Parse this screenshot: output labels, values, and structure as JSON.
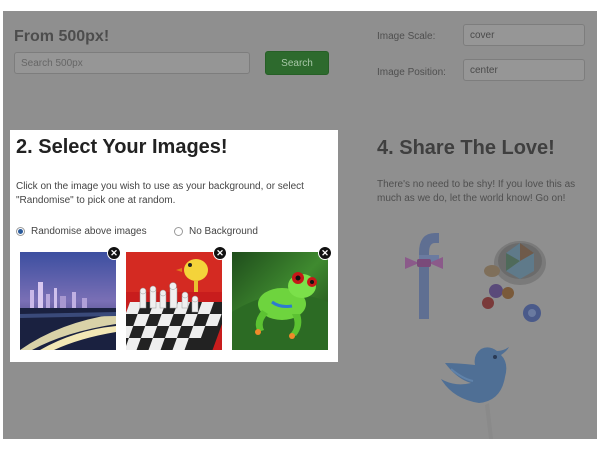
{
  "search": {
    "title": "From 500px!",
    "placeholder": "Search 500px",
    "button_label": "Search"
  },
  "options": {
    "scale_label": "Image Scale:",
    "scale_value": "cover",
    "position_label": "Image Position:",
    "position_value": "center"
  },
  "select": {
    "title": "2. Select Your Images!",
    "description": "Click on the image you wish to use as your background, or select \"Randomise\" to pick one at random.",
    "radio_randomise": "Randomise above images",
    "radio_none": "No Background",
    "selected": "randomise",
    "images": [
      {
        "name": "city-night-image",
        "remove_icon": "close-icon"
      },
      {
        "name": "chess-toy-image",
        "remove_icon": "close-icon"
      },
      {
        "name": "tree-frog-image",
        "remove_icon": "close-icon"
      }
    ],
    "remove_glyph": "✕"
  },
  "share": {
    "title": "4. Share The Love!",
    "description": "There's no need to be shy! If you love this as much as we do, let the world know! Go on!",
    "icons": [
      "facebook-icon",
      "google-buttons-icon",
      "twitter-bird-icon"
    ]
  },
  "colors": {
    "accent_green": "#2d6a2d",
    "overlay_gray": "#8f8f8f",
    "panel_white": "#ffffff"
  }
}
